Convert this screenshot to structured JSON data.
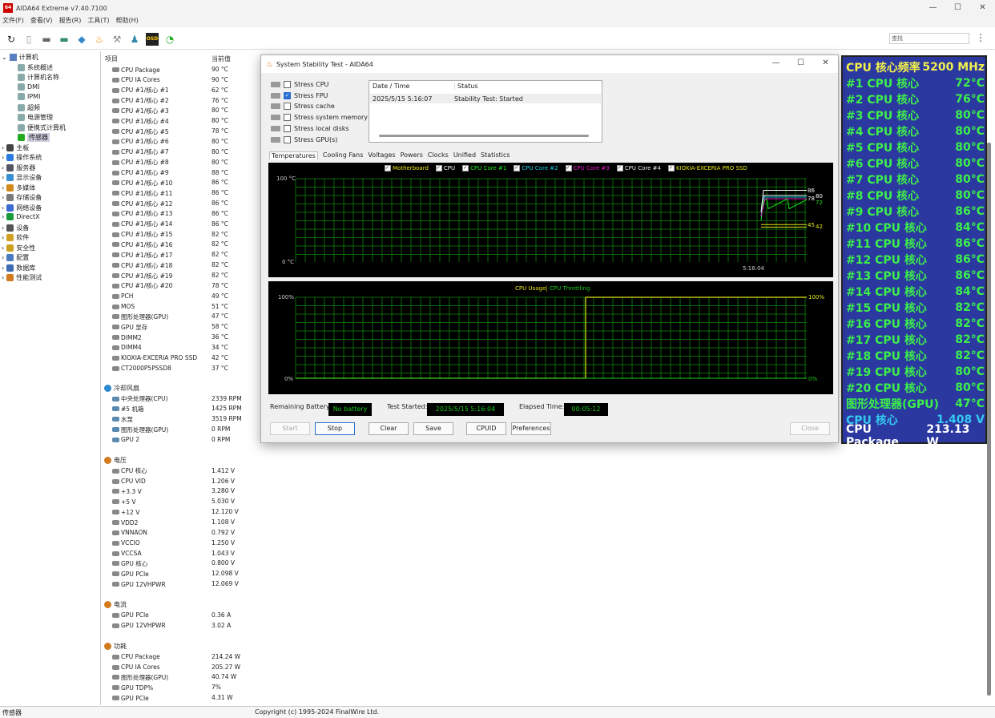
{
  "app": {
    "title": "AIDA64 Extreme v7.40.7100",
    "icon_label": "64",
    "menu": [
      "文件(F)",
      "查看(V)",
      "报告(R)",
      "工具(T)",
      "帮助(H)"
    ],
    "search_placeholder": "查找",
    "toolbar_icons": [
      "refresh-icon",
      "report-icon",
      "motherboard-icon",
      "memory-icon",
      "network-icon",
      "flame-icon",
      "benchmark-icon",
      "user-icon",
      "osd-icon",
      "gauge-icon"
    ],
    "status_left": "传感器",
    "status_center": "Copyright (c) 1995-2024 FinalWire Ltd."
  },
  "tree": {
    "root": "计算机",
    "children": [
      "系统概述",
      "计算机名称",
      "DMI",
      "IPMI",
      "超频",
      "电源管理",
      "便携式计算机",
      "传感器"
    ],
    "groups": [
      "主板",
      "操作系统",
      "服务器",
      "显示设备",
      "多媒体",
      "存储设备",
      "网络设备",
      "DirectX",
      "设备",
      "软件",
      "安全性",
      "配置",
      "数据库",
      "性能测试"
    ]
  },
  "list": {
    "col_item": "项目",
    "col_value": "当前值",
    "temps": [
      [
        "CPU Package",
        "90 °C"
      ],
      [
        "CPU IA Cores",
        "90 °C"
      ],
      [
        "CPU #1/核心 #1",
        "62 °C"
      ],
      [
        "CPU #1/核心 #2",
        "76 °C"
      ],
      [
        "CPU #1/核心 #3",
        "80 °C"
      ],
      [
        "CPU #1/核心 #4",
        "80 °C"
      ],
      [
        "CPU #1/核心 #5",
        "78 °C"
      ],
      [
        "CPU #1/核心 #6",
        "80 °C"
      ],
      [
        "CPU #1/核心 #7",
        "80 °C"
      ],
      [
        "CPU #1/核心 #8",
        "80 °C"
      ],
      [
        "CPU #1/核心 #9",
        "88 °C"
      ],
      [
        "CPU #1/核心 #10",
        "86 °C"
      ],
      [
        "CPU #1/核心 #11",
        "86 °C"
      ],
      [
        "CPU #1/核心 #12",
        "86 °C"
      ],
      [
        "CPU #1/核心 #13",
        "86 °C"
      ],
      [
        "CPU #1/核心 #14",
        "86 °C"
      ],
      [
        "CPU #1/核心 #15",
        "82 °C"
      ],
      [
        "CPU #1/核心 #16",
        "82 °C"
      ],
      [
        "CPU #1/核心 #17",
        "82 °C"
      ],
      [
        "CPU #1/核心 #18",
        "82 °C"
      ],
      [
        "CPU #1/核心 #19",
        "82 °C"
      ],
      [
        "CPU #1/核心 #20",
        "78 °C"
      ],
      [
        "PCH",
        "49 °C"
      ],
      [
        "MOS",
        "51 °C"
      ],
      [
        "图形处理器(GPU)",
        "47 °C"
      ],
      [
        "GPU 显存",
        "58 °C"
      ],
      [
        "DIMM2",
        "36 °C"
      ],
      [
        "DIMM4",
        "34 °C"
      ],
      [
        "KIOXIA-EXCERIA PRO SSD",
        "42 °C"
      ],
      [
        "CT2000P5PSSD8",
        "37 °C"
      ]
    ],
    "fans_title": "冷却风扇",
    "fans": [
      [
        "中央处理器(CPU)",
        "2339 RPM"
      ],
      [
        "#5 机箱",
        "1425 RPM"
      ],
      [
        "水泵",
        "3519 RPM"
      ],
      [
        "图形处理器(GPU)",
        "0 RPM"
      ],
      [
        "GPU 2",
        "0 RPM"
      ]
    ],
    "volt_title": "电压",
    "volts": [
      [
        "CPU 核心",
        "1.412 V"
      ],
      [
        "CPU VID",
        "1.206 V"
      ],
      [
        "+3.3 V",
        "3.280 V"
      ],
      [
        "+5 V",
        "5.030 V"
      ],
      [
        "+12 V",
        "12.120 V"
      ],
      [
        "VDD2",
        "1.108 V"
      ],
      [
        "VNNAON",
        "0.792 V"
      ],
      [
        "VCCIO",
        "1.250 V"
      ],
      [
        "VCCSA",
        "1.043 V"
      ],
      [
        "GPU 核心",
        "0.800 V"
      ],
      [
        "GPU PCIe",
        "12.098 V"
      ],
      [
        "GPU 12VHPWR",
        "12.069 V"
      ]
    ],
    "curr_title": "电流",
    "currs": [
      [
        "GPU PCIe",
        "0.36 A"
      ],
      [
        "GPU 12VHPWR",
        "3.02 A"
      ]
    ],
    "power_title": "功耗",
    "powers": [
      [
        "CPU Package",
        "214.24 W"
      ],
      [
        "CPU IA Cores",
        "205.27 W"
      ],
      [
        "图形处理器(GPU)",
        "40.74 W"
      ],
      [
        "GPU TDP%",
        "7%"
      ],
      [
        "GPU PCIe",
        "4.31 W"
      ]
    ]
  },
  "dialog": {
    "title": "System Stability Test - AIDA64",
    "stress": [
      {
        "label": "Stress CPU",
        "checked": false
      },
      {
        "label": "Stress FPU",
        "checked": true
      },
      {
        "label": "Stress cache",
        "checked": false
      },
      {
        "label": "Stress system memory",
        "checked": false
      },
      {
        "label": "Stress local disks",
        "checked": false
      },
      {
        "label": "Stress GPU(s)",
        "checked": false
      }
    ],
    "log_headers": [
      "Date / Time",
      "Status"
    ],
    "log_row": [
      "2025/5/15 5:16:07",
      "Stability Test: Started"
    ],
    "tabs": [
      "Temperatures",
      "Cooling Fans",
      "Voltages",
      "Powers",
      "Clocks",
      "Unified",
      "Statistics"
    ],
    "temp_legend": [
      {
        "label": "Motherboard",
        "color": "#e6e617"
      },
      {
        "label": "CPU",
        "color": "#ffffff"
      },
      {
        "label": "CPU Core #1",
        "color": "#19e619"
      },
      {
        "label": "CPU Core #2",
        "color": "#17c9e6"
      },
      {
        "label": "CPU Core #3",
        "color": "#e617c9"
      },
      {
        "label": "CPU Core #4",
        "color": "#e6e6e6"
      },
      {
        "label": "KIOXIA-EXCERIA PRO SSD",
        "color": "#e6e617"
      }
    ],
    "temp_y_max": "100 °C",
    "temp_y_min": "0 °C",
    "temp_time": "5:16:04",
    "temp_end_labels": [
      "86",
      "80",
      "78",
      "72",
      "45",
      "42"
    ],
    "usage_legend": [
      "CPU Usage",
      "CPU Throttling"
    ],
    "usage_legend_colors": [
      "#e6e617",
      "#19c919"
    ],
    "usage_left_top": "100%",
    "usage_left_bottom": "0%",
    "usage_right_top": "100%",
    "usage_right_bottom": "0%",
    "remaining_battery_label": "Remaining Battery:",
    "remaining_battery": "No battery",
    "test_started_label": "Test Started:",
    "test_started": "2025/5/15 5:16:04",
    "elapsed_label": "Elapsed Time:",
    "elapsed": "00:05:12",
    "buttons": [
      "Start",
      "Stop",
      "Clear",
      "Save",
      "CPUID",
      "Preferences",
      "Close"
    ]
  },
  "osd": {
    "rows": [
      {
        "label": "CPU 核心频率",
        "value": "5200 MHz",
        "color": "#f2f24a"
      },
      {
        "label": "#1 CPU 核心",
        "value": "72°C",
        "color": "#3cf04a"
      },
      {
        "label": "#2 CPU 核心",
        "value": "76°C",
        "color": "#3cf04a"
      },
      {
        "label": "#3 CPU 核心",
        "value": "80°C",
        "color": "#3cf04a"
      },
      {
        "label": "#4 CPU 核心",
        "value": "80°C",
        "color": "#3cf04a"
      },
      {
        "label": "#5 CPU 核心",
        "value": "80°C",
        "color": "#3cf04a"
      },
      {
        "label": "#6 CPU 核心",
        "value": "80°C",
        "color": "#3cf04a"
      },
      {
        "label": "#7 CPU 核心",
        "value": "80°C",
        "color": "#3cf04a"
      },
      {
        "label": "#8 CPU 核心",
        "value": "80°C",
        "color": "#3cf04a"
      },
      {
        "label": "#9 CPU 核心",
        "value": "86°C",
        "color": "#3cf04a"
      },
      {
        "label": "#10 CPU 核心",
        "value": "84°C",
        "color": "#3cf04a"
      },
      {
        "label": "#11 CPU 核心",
        "value": "86°C",
        "color": "#3cf04a"
      },
      {
        "label": "#12 CPU 核心",
        "value": "86°C",
        "color": "#3cf04a"
      },
      {
        "label": "#13 CPU 核心",
        "value": "86°C",
        "color": "#3cf04a"
      },
      {
        "label": "#14 CPU 核心",
        "value": "84°C",
        "color": "#3cf04a"
      },
      {
        "label": "#15 CPU 核心",
        "value": "82°C",
        "color": "#3cf04a"
      },
      {
        "label": "#16 CPU 核心",
        "value": "82°C",
        "color": "#3cf04a"
      },
      {
        "label": "#17 CPU 核心",
        "value": "82°C",
        "color": "#3cf04a"
      },
      {
        "label": "#18 CPU 核心",
        "value": "82°C",
        "color": "#3cf04a"
      },
      {
        "label": "#19 CPU 核心",
        "value": "80°C",
        "color": "#3cf04a"
      },
      {
        "label": "#20 CPU 核心",
        "value": "80°C",
        "color": "#3cf04a"
      },
      {
        "label": "图形处理器(GPU)",
        "value": "47°C",
        "color": "#3cf04a"
      },
      {
        "label": "CPU 核心",
        "value": "1.408 V",
        "color": "#35c8f0"
      },
      {
        "label": "CPU Package",
        "value": "213.13 W",
        "color": "#ffffff"
      }
    ]
  }
}
